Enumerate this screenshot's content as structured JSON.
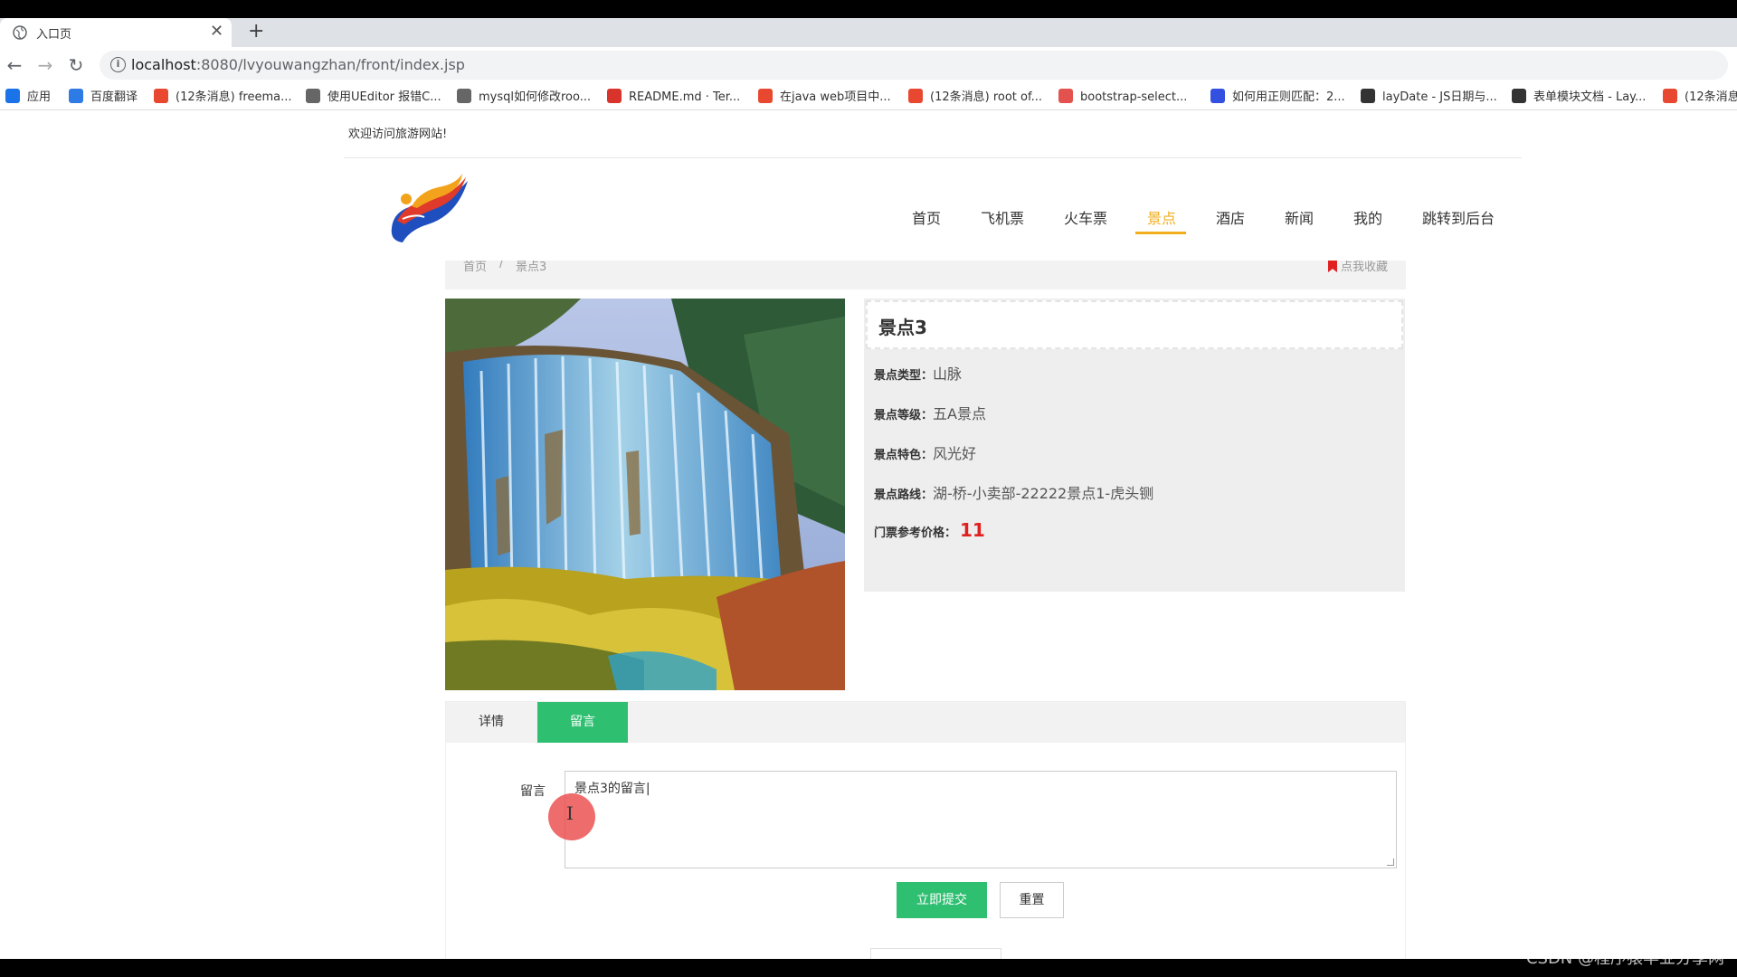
{
  "browser": {
    "tab_title": "入口页",
    "tab_close": "✕",
    "new_tab": "+",
    "url_host": "localhost",
    "url_rest": ":8080/lvyouwangzhan/front/index.jsp",
    "bookmarks": [
      {
        "label": "应用",
        "color": "#1a73e8",
        "icon": "apps-grid-icon"
      },
      {
        "label": "百度翻译",
        "color": "#2f7be5",
        "icon": "translate-icon"
      },
      {
        "label": "(12条消息) freema...",
        "color": "#e8482f",
        "icon": "csdn-icon"
      },
      {
        "label": "使用UEditor 报错C...",
        "color": "#666666",
        "icon": "link-icon"
      },
      {
        "label": "mysql如何修改roo...",
        "color": "#666666",
        "icon": "link-icon"
      },
      {
        "label": "README.md · Ter...",
        "color": "#d9342b",
        "icon": "gitee-icon"
      },
      {
        "label": "在java web项目中...",
        "color": "#e8482f",
        "icon": "csdn-icon"
      },
      {
        "label": "(12条消息) root of...",
        "color": "#e8482f",
        "icon": "csdn-icon"
      },
      {
        "label": "bootstrap-select...",
        "color": "#e4524f",
        "icon": "site-icon"
      },
      {
        "label": "如何用正则匹配：2...",
        "color": "#3350e0",
        "icon": "baidu-icon"
      },
      {
        "label": "layDate - JS日期与...",
        "color": "#333333",
        "icon": "layui-icon"
      },
      {
        "label": "表单模块文档 - Lay...",
        "color": "#333333",
        "icon": "layui-icon"
      },
      {
        "label": "(12条消息",
        "color": "#e8482f",
        "icon": "csdn-icon"
      }
    ]
  },
  "site": {
    "welcome": "欢迎访问旅游网站!",
    "nav": [
      "首页",
      "飞机票",
      "火车票",
      "景点",
      "酒店",
      "新闻",
      "我的",
      "跳转到后台"
    ],
    "active_nav": "景点",
    "accent": "#f0ad1c"
  },
  "breadcrumb": {
    "home": "首页",
    "sep": "/",
    "current": "景点3",
    "favorite": "点我收藏"
  },
  "detail": {
    "name": "景点3",
    "rows": [
      {
        "label": "景点类型：",
        "value": "山脉"
      },
      {
        "label": "景点等级：",
        "value": "五A景点"
      },
      {
        "label": "景点特色：",
        "value": "风光好"
      },
      {
        "label": "景点路线：",
        "value": "湖-桥-小卖部-22222景点1-虎头铡"
      }
    ],
    "price_label": "门票参考价格：",
    "price": "11"
  },
  "tabs": {
    "items": [
      "详情",
      "留言"
    ],
    "active": "留言"
  },
  "comment": {
    "label": "留言",
    "value": "景点3的留言",
    "submit": "立即提交",
    "reset": "重置"
  },
  "watermark": "CSDN @程序猿毕业分享网"
}
